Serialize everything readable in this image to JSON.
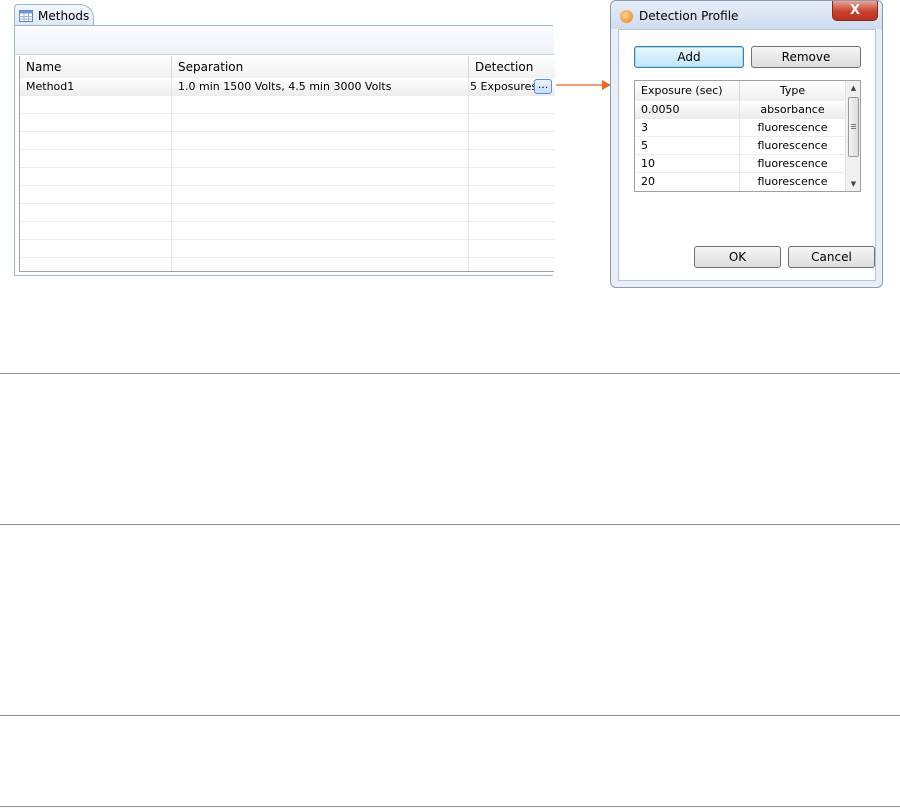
{
  "methods_panel": {
    "tab_label": "Methods",
    "columns": [
      "Name",
      "Separation",
      "Detection"
    ],
    "rows": [
      {
        "name": "Method1",
        "separation": "1.0 min 1500 Volts, 4.5 min 3000 Volts",
        "detection": "5 Exposures",
        "button": "..."
      }
    ]
  },
  "dialog": {
    "title": "Detection Profile",
    "close_label": "X",
    "add_label": "Add",
    "remove_label": "Remove",
    "columns": [
      "Exposure (sec)",
      "Type"
    ],
    "rows": [
      {
        "exposure": "0.0050",
        "type": "absorbance"
      },
      {
        "exposure": "3",
        "type": "fluorescence"
      },
      {
        "exposure": "5",
        "type": "fluorescence"
      },
      {
        "exposure": "10",
        "type": "fluorescence"
      },
      {
        "exposure": "20",
        "type": "fluorescence"
      }
    ],
    "ok_label": "OK",
    "cancel_label": "Cancel"
  },
  "colors": {
    "arrow": "#e2692a",
    "close_button": "#c7412c"
  },
  "icons": {
    "tab": "table-grid-icon",
    "dialog": "app-logo-icon",
    "close": "close-icon",
    "scroll_up": "chevron-up-icon",
    "scroll_down": "chevron-down-icon"
  }
}
